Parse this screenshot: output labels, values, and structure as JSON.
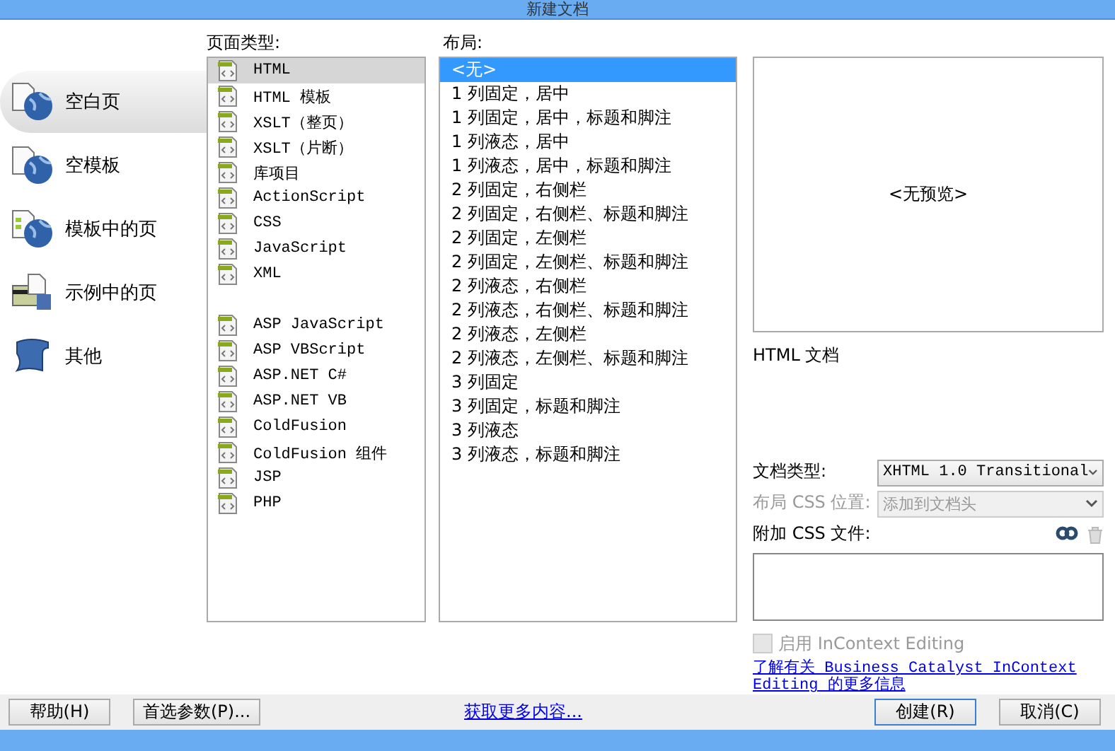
{
  "window": {
    "title": "新建文档"
  },
  "categories": [
    {
      "label": "空白页",
      "kind": "page",
      "selected": true
    },
    {
      "label": "空模板",
      "kind": "page",
      "selected": false
    },
    {
      "label": "模板中的页",
      "kind": "template",
      "selected": false
    },
    {
      "label": "示例中的页",
      "kind": "sample",
      "selected": false
    },
    {
      "label": "其他",
      "kind": "other",
      "selected": false
    }
  ],
  "page_types": {
    "label": "页面类型:",
    "groups": [
      [
        {
          "label": "HTML",
          "selected": true
        },
        {
          "label": "HTML 模板",
          "selected": false
        },
        {
          "label": "XSLT（整页）",
          "selected": false
        },
        {
          "label": "XSLT（片断）",
          "selected": false
        },
        {
          "label": "库项目",
          "selected": false
        },
        {
          "label": "ActionScript",
          "selected": false
        },
        {
          "label": "CSS",
          "selected": false
        },
        {
          "label": "JavaScript",
          "selected": false
        },
        {
          "label": "XML",
          "selected": false
        }
      ],
      [
        {
          "label": "ASP JavaScript",
          "selected": false
        },
        {
          "label": "ASP VBScript",
          "selected": false
        },
        {
          "label": "ASP.NET C#",
          "selected": false
        },
        {
          "label": "ASP.NET VB",
          "selected": false
        },
        {
          "label": "ColdFusion",
          "selected": false
        },
        {
          "label": "ColdFusion 组件",
          "selected": false
        },
        {
          "label": "JSP",
          "selected": false
        },
        {
          "label": "PHP",
          "selected": false
        }
      ]
    ]
  },
  "layouts": {
    "label": "布局:",
    "items": [
      {
        "label": "<无>",
        "selected": true
      },
      {
        "label": "1 列固定，居中",
        "selected": false
      },
      {
        "label": "1 列固定，居中，标题和脚注",
        "selected": false
      },
      {
        "label": "1 列液态，居中",
        "selected": false
      },
      {
        "label": "1 列液态，居中，标题和脚注",
        "selected": false
      },
      {
        "label": "2 列固定，右侧栏",
        "selected": false
      },
      {
        "label": "2 列固定，右侧栏、标题和脚注",
        "selected": false
      },
      {
        "label": "2 列固定，左侧栏",
        "selected": false
      },
      {
        "label": "2 列固定，左侧栏、标题和脚注",
        "selected": false
      },
      {
        "label": "2 列液态，右侧栏",
        "selected": false
      },
      {
        "label": "2 列液态，右侧栏、标题和脚注",
        "selected": false
      },
      {
        "label": "2 列液态，左侧栏",
        "selected": false
      },
      {
        "label": "2 列液态，左侧栏、标题和脚注",
        "selected": false
      },
      {
        "label": "3 列固定",
        "selected": false
      },
      {
        "label": "3 列固定，标题和脚注",
        "selected": false
      },
      {
        "label": "3 列液态",
        "selected": false
      },
      {
        "label": "3 列液态，标题和脚注",
        "selected": false
      }
    ]
  },
  "preview": {
    "text": "<无预览>",
    "description": "HTML 文档"
  },
  "doc_type": {
    "label": "文档类型:",
    "value": "XHTML 1.0 Transitional",
    "disabled": false
  },
  "layout_css": {
    "label": "布局 CSS 位置:",
    "value": "添加到文档头",
    "disabled": true
  },
  "attach_css": {
    "label": "附加 CSS 文件:"
  },
  "incontext": {
    "label": "启用 InContext Editing",
    "checked": false,
    "disabled": true
  },
  "info_link": "了解有关 Business Catalyst InContext Editing 的更多信息",
  "footer": {
    "help": "帮助(H)",
    "prefs": "首选参数(P)...",
    "more": "获取更多内容...",
    "create": "创建(R)",
    "cancel": "取消(C)"
  }
}
